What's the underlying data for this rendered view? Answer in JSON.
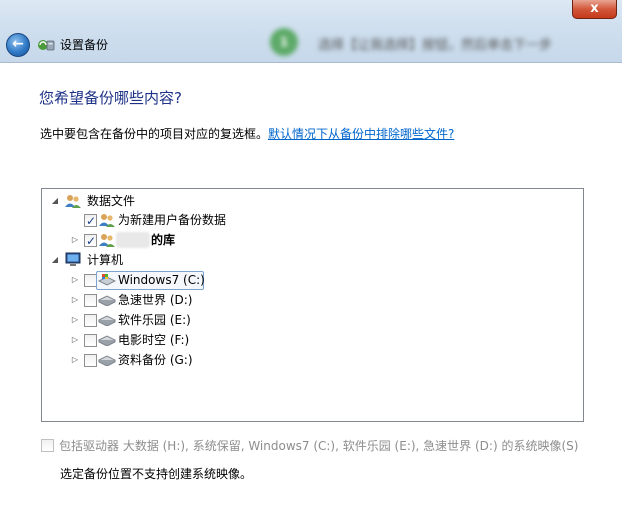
{
  "window": {
    "close_label": "x",
    "back_label": "←",
    "title": "设置备份",
    "hint": {
      "step": "1",
      "text": "选择【让我选择】按钮，然后单击下一步"
    }
  },
  "content": {
    "heading": "您希望备份哪些内容?",
    "description": "选中要包含在备份中的项目对应的复选框。",
    "link": "默认情况下从备份中排除哪些文件?",
    "tree": {
      "data_files": {
        "label": "数据文件",
        "children": [
          {
            "label": "为新建用户备份数据",
            "checked": true
          },
          {
            "label": "的库",
            "checked": true
          }
        ]
      },
      "computer": {
        "label": "计算机",
        "drives": [
          {
            "label": "Windows7 (C:)",
            "checked": false
          },
          {
            "label": "急速世界 (D:)",
            "checked": false
          },
          {
            "label": "软件乐园 (E:)",
            "checked": false
          },
          {
            "label": "电影时空 (F:)",
            "checked": false
          },
          {
            "label": "资料备份 (G:)",
            "checked": false
          }
        ]
      }
    },
    "system_image": {
      "label": "包括驱动器 大数据 (H:), 系统保留, Windows7 (C:), 软件乐园 (E:), 急速世界 (D:) 的系统映像(S)",
      "checked": false,
      "enabled": false
    },
    "note": "选定备份位置不支持创建系统映像。"
  }
}
